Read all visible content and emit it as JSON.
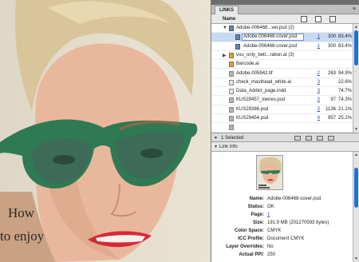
{
  "canvas": {
    "ad_line_1": "How",
    "ad_line_2": "to enjoy"
  },
  "panel": {
    "tab_label": "LINKS",
    "menu_icon": "panel-menu-icon",
    "column_name": "Name",
    "header_icons": [
      "sort-icon",
      "page-icon",
      "info-icon"
    ]
  },
  "links": [
    {
      "indent": 0,
      "twisty": "▼",
      "icon": "psd",
      "name": "Adobe-006468...ver.psd (2)",
      "page": "",
      "ppi": "",
      "pct": ""
    },
    {
      "indent": 2,
      "twisty": "",
      "icon": "psd",
      "name": "Adobe-006468-cover.psd",
      "page": "1",
      "ppi": "300",
      "pct": "83.4%",
      "selected": true
    },
    {
      "indent": 2,
      "twisty": "",
      "icon": "psd",
      "name": "Adobe-006468-cover.psd",
      "page": "1",
      "ppi": "300",
      "pct": "83.4%"
    },
    {
      "indent": 0,
      "twisty": "▶",
      "icon": "ai",
      "name": "vou_only_bett...ration.ai (3)",
      "page": "",
      "ppi": "",
      "pct": ""
    },
    {
      "indent": 0,
      "twisty": "",
      "icon": "doc",
      "name": "Barcode.ai",
      "page": "",
      "ppi": "",
      "pct": ""
    },
    {
      "indent": 0,
      "twisty": "",
      "icon": "doc",
      "name": "Adobe-005942.tif",
      "page": "2",
      "ppi": "263",
      "pct": "94.9%"
    },
    {
      "indent": 0,
      "twisty": "",
      "icon": "doc",
      "name": "check_masthead_white.ai",
      "page": "3",
      "ppi": "",
      "pct": "22.6%"
    },
    {
      "indent": 0,
      "twisty": "",
      "icon": "doc",
      "name": "Data_Addict_page.indd",
      "page": "3",
      "ppi": "",
      "pct": "74.7%"
    },
    {
      "indent": 0,
      "twisty": "",
      "icon": "doc",
      "name": "KUS29457_lowres.psd",
      "page": "3",
      "ppi": "97",
      "pct": "74.3%"
    },
    {
      "indent": 0,
      "twisty": "",
      "icon": "doc",
      "name": "KUS29386.psd",
      "page": "3",
      "ppi": "1136",
      "pct": "21.1%"
    },
    {
      "indent": 0,
      "twisty": "",
      "icon": "doc",
      "name": "KUS29454.psd",
      "page": "4",
      "ppi": "957",
      "pct": "25.1%"
    },
    {
      "indent": 0,
      "twisty": "",
      "icon": "doc",
      "name": "",
      "page": "",
      "ppi": "",
      "pct": ""
    }
  ],
  "status": {
    "selected_text": "1 Selected",
    "icons": [
      "relink-icon",
      "goto-link-icon",
      "update-link-icon",
      "edit-original-icon"
    ]
  },
  "link_info": {
    "title": "Link Info",
    "rows": [
      {
        "key": "Name:",
        "value": "Adobe-006468-cover.psd"
      },
      {
        "key": "Status:",
        "value": "OK"
      },
      {
        "key": "Page:",
        "value": "1"
      },
      {
        "key": "Size:",
        "value": "191.9 MB (201270593 bytes)"
      },
      {
        "key": "Color Space:",
        "value": "CMYK"
      },
      {
        "key": "ICC Profile:",
        "value": "Document CMYK"
      },
      {
        "key": "Layer Overrides:",
        "value": "No"
      },
      {
        "key": "Actual PPI:",
        "value": "250"
      }
    ]
  },
  "colors": {
    "selection": "#c7dcf3",
    "scroll_thumb": "#1f71d6",
    "link_blue": "#2b4fa8"
  }
}
